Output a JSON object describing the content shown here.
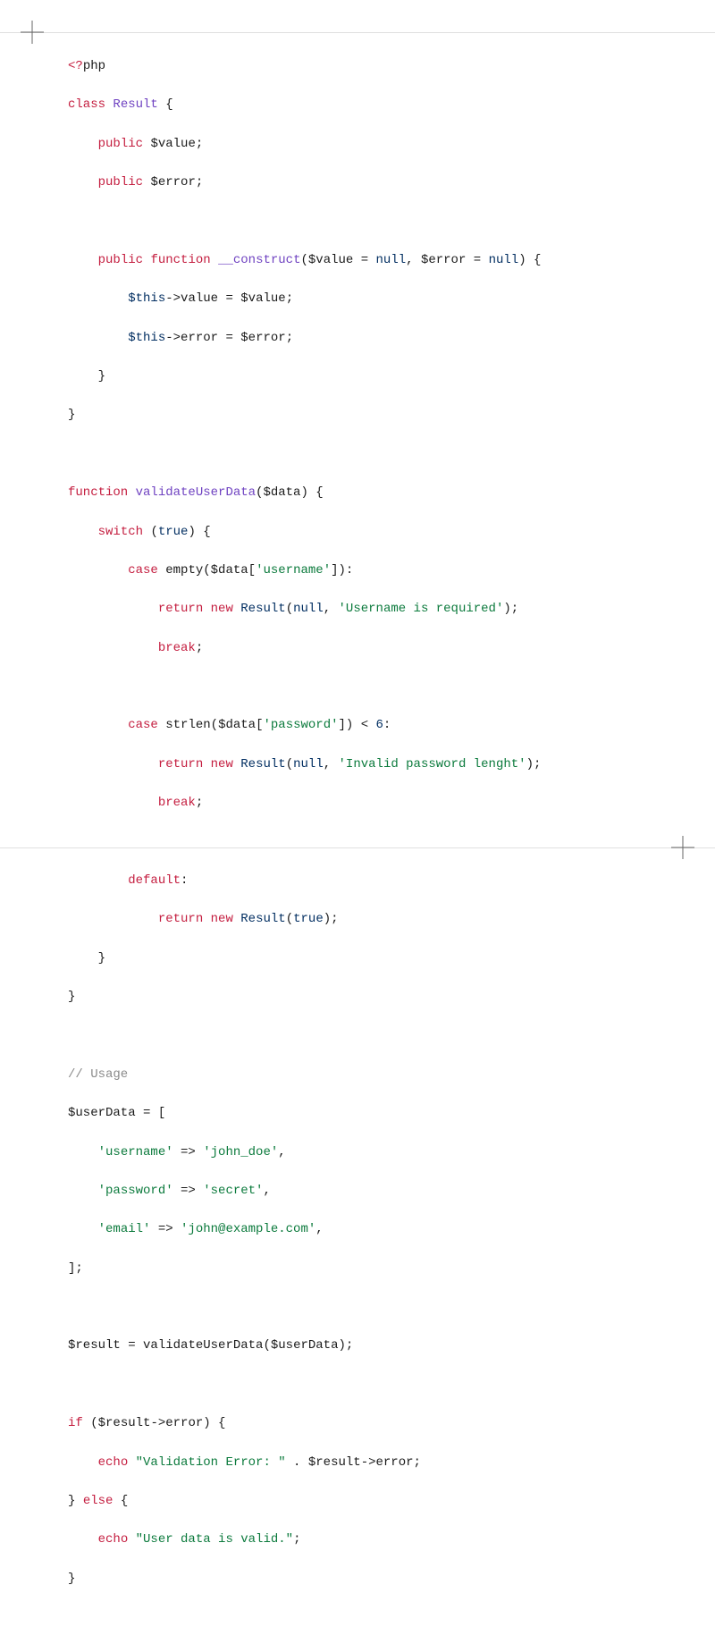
{
  "code": {
    "lines": {
      "l1": "<?php",
      "l2_a": "class",
      "l2_b": "Result",
      "l2_c": "{",
      "l3_a": "public",
      "l3_b": "$value",
      "l3_c": ";",
      "l4_a": "public",
      "l4_b": "$error",
      "l4_c": ";",
      "l6_a": "public",
      "l6_b": "function",
      "l6_c": "__construct",
      "l6_d": "(",
      "l6_e": "$value",
      "l6_f": " = ",
      "l6_g": "null",
      "l6_h": ", ",
      "l6_i": "$error",
      "l6_j": " = ",
      "l6_k": "null",
      "l6_l": ") {",
      "l7_a": "$this",
      "l7_b": "->",
      "l7_c": "value = ",
      "l7_d": "$value",
      "l7_e": ";",
      "l8_a": "$this",
      "l8_b": "->",
      "l8_c": "error = ",
      "l8_d": "$error",
      "l8_e": ";",
      "l9": "}",
      "l10": "}",
      "l12_a": "function",
      "l12_b": "validateUserData",
      "l12_c": "(",
      "l12_d": "$data",
      "l12_e": ") {",
      "l13_a": "switch",
      "l13_b": "(",
      "l13_c": "true",
      "l13_d": ") {",
      "l14_a": "case",
      "l14_b": "empty",
      "l14_c": "(",
      "l14_d": "$data",
      "l14_e": "[",
      "l14_f": "'username'",
      "l14_g": "]):",
      "l15_a": "return",
      "l15_b": "new",
      "l15_c": "Result",
      "l15_d": "(",
      "l15_e": "null",
      "l15_f": ", ",
      "l15_g": "'Username is required'",
      "l15_h": ");",
      "l16_a": "break",
      "l16_b": ";",
      "l18_a": "case",
      "l18_b": "strlen",
      "l18_c": "(",
      "l18_d": "$data",
      "l18_e": "[",
      "l18_f": "'password'",
      "l18_g": "]) < ",
      "l18_h": "6",
      "l18_i": ":",
      "l19_a": "return",
      "l19_b": "new",
      "l19_c": "Result",
      "l19_d": "(",
      "l19_e": "null",
      "l19_f": ", ",
      "l19_g": "'Invalid password lenght'",
      "l19_h": ");",
      "l20_a": "break",
      "l20_b": ";",
      "l22_a": "default",
      "l22_b": ":",
      "l23_a": "return",
      "l23_b": "new",
      "l23_c": "Result",
      "l23_d": "(",
      "l23_e": "true",
      "l23_f": ");",
      "l24": "}",
      "l25": "}",
      "l27": "// Usage",
      "l28_a": "$userData",
      "l28_b": " = [",
      "l29_a": "'username'",
      "l29_b": " => ",
      "l29_c": "'john_doe'",
      "l29_d": ",",
      "l30_a": "'password'",
      "l30_b": " => ",
      "l30_c": "'secret'",
      "l30_d": ",",
      "l31_a": "'email'",
      "l31_b": " => ",
      "l31_c": "'john@example.com'",
      "l31_d": ",",
      "l32": "];",
      "l34_a": "$result",
      "l34_b": " = ",
      "l34_c": "validateUserData",
      "l34_d": "(",
      "l34_e": "$userData",
      "l34_f": ");",
      "l36_a": "if",
      "l36_b": " (",
      "l36_c": "$result",
      "l36_d": "->",
      "l36_e": "error) {",
      "l37_a": "echo",
      "l37_b": " ",
      "l37_c": "\"Validation Error: \"",
      "l37_d": " . ",
      "l37_e": "$result",
      "l37_f": "->",
      "l37_g": "error;",
      "l38_a": "} ",
      "l38_b": "else",
      "l38_c": " {",
      "l39_a": "echo",
      "l39_b": " ",
      "l39_c": "\"User data is valid.\"",
      "l39_d": ";",
      "l40": "}"
    }
  }
}
